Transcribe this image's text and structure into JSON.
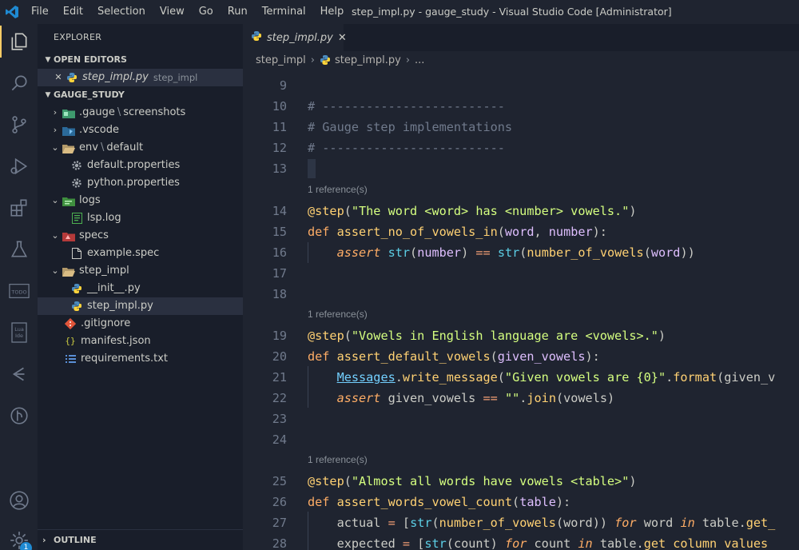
{
  "window": {
    "title": "step_impl.py - gauge_study - Visual Studio Code [Administrator]",
    "menu": [
      "File",
      "Edit",
      "Selection",
      "View",
      "Go",
      "Run",
      "Terminal",
      "Help"
    ]
  },
  "activity_bar": {
    "items": [
      "explorer-icon",
      "search-icon",
      "source-control-icon",
      "run-debug-icon",
      "extensions-icon",
      "testing-flask-icon",
      "todo-icon",
      "lua-ide-icon",
      "gauge-icon",
      "git-graph-icon",
      "account-icon",
      "settings-gear-icon"
    ],
    "todo_label": "TODO",
    "lua_label": "Lua Ide",
    "settings_badge": "1"
  },
  "sidebar": {
    "title": "EXPLORER",
    "open_editors": {
      "header": "OPEN EDITORS",
      "items": [
        {
          "name": "step_impl.py",
          "desc": "step_impl"
        }
      ]
    },
    "project": {
      "header": "GAUGE_STUDY",
      "items": [
        {
          "name": ".gauge",
          "sub": "screenshots",
          "type": "folder",
          "state": "collapsed"
        },
        {
          "name": ".vscode",
          "type": "folder",
          "state": "collapsed"
        },
        {
          "name": "env",
          "sub": "default",
          "type": "folder",
          "state": "expanded"
        },
        {
          "name": "default.properties",
          "type": "file"
        },
        {
          "name": "python.properties",
          "type": "file"
        },
        {
          "name": "logs",
          "type": "folder",
          "state": "expanded"
        },
        {
          "name": "lsp.log",
          "type": "file"
        },
        {
          "name": "specs",
          "type": "folder",
          "state": "expanded"
        },
        {
          "name": "example.spec",
          "type": "file"
        },
        {
          "name": "step_impl",
          "type": "folder",
          "state": "expanded"
        },
        {
          "name": "__init__.py",
          "type": "file"
        },
        {
          "name": "step_impl.py",
          "type": "file",
          "selected": true
        },
        {
          "name": ".gitignore",
          "type": "file"
        },
        {
          "name": "manifest.json",
          "type": "file"
        },
        {
          "name": "requirements.txt",
          "type": "file"
        }
      ]
    },
    "outline": "OUTLINE"
  },
  "editor": {
    "tab": "step_impl.py",
    "breadcrumbs": [
      "step_impl",
      "step_impl.py",
      "..."
    ],
    "lens_text": "1 reference(s)",
    "line_numbers": [
      "9",
      "10",
      "11",
      "12",
      "13",
      "14",
      "15",
      "16",
      "17",
      "18",
      "19",
      "20",
      "21",
      "22",
      "23",
      "24",
      "25",
      "26",
      "27",
      "28"
    ],
    "code": {
      "l10": "# -------------------------",
      "l11": "# Gauge step implementations",
      "l12": "# -------------------------",
      "l14_dec": "@step",
      "l14_str": "\"The word <word> has <number> vowels.\"",
      "l15_fn": "assert_no_of_vowels_in",
      "l15_p1": "word",
      "l15_p2": "number",
      "l16_fn": "number_of_vowels",
      "l16_a1": "number",
      "l16_a2": "word",
      "l19_str": "\"Vowels in English language are <vowels>.\"",
      "l20_fn": "assert_default_vowels",
      "l20_p1": "given_vowels",
      "l21_cls": "Messages",
      "l21_fn": "write_message",
      "l21_str": "\"Given vowels are {0}\"",
      "l21_fmt": "format",
      "l21_tail": "(given_v",
      "l22_v": "given_vowels",
      "l22_str": "\"\"",
      "l22_fn": "join",
      "l22_a": "vowels",
      "l25_str": "\"Almost all words have vowels <table>\"",
      "l26_fn": "assert_words_vowel_count",
      "l26_p1": "table",
      "l27_v": "actual",
      "l27_fn": "number_of_vowels",
      "l27_a": "word",
      "l27_w": "word",
      "l27_t": "table",
      "l27_get": "get_",
      "l28_v": "expected",
      "l28_a": "count",
      "l28_c": "count",
      "l28_t": "table",
      "l28_get": "get_column_values_"
    }
  }
}
